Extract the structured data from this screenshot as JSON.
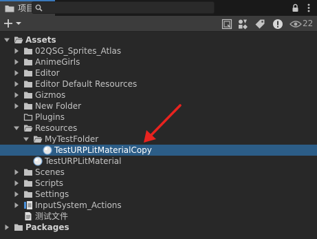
{
  "tab": {
    "label": "项目"
  },
  "toolbar": {
    "search_value": "",
    "search_placeholder": "",
    "hidden_count": "22"
  },
  "tree": [
    {
      "label": "Assets",
      "depth": 0,
      "expanded": true,
      "hasArrow": true,
      "icon": "folder-open",
      "bold": true,
      "selected": false
    },
    {
      "label": "02QSG_Sprites_Atlas",
      "depth": 1,
      "expanded": false,
      "hasArrow": true,
      "icon": "folder",
      "bold": false,
      "selected": false
    },
    {
      "label": "AnimeGirls",
      "depth": 1,
      "expanded": false,
      "hasArrow": true,
      "icon": "folder",
      "bold": false,
      "selected": false
    },
    {
      "label": "Editor",
      "depth": 1,
      "expanded": false,
      "hasArrow": true,
      "icon": "folder",
      "bold": false,
      "selected": false
    },
    {
      "label": "Editor Default Resources",
      "depth": 1,
      "expanded": false,
      "hasArrow": true,
      "icon": "folder",
      "bold": false,
      "selected": false
    },
    {
      "label": "Gizmos",
      "depth": 1,
      "expanded": false,
      "hasArrow": true,
      "icon": "folder",
      "bold": false,
      "selected": false
    },
    {
      "label": "New Folder",
      "depth": 1,
      "expanded": false,
      "hasArrow": true,
      "icon": "folder",
      "bold": false,
      "selected": false
    },
    {
      "label": "Plugins",
      "depth": 1,
      "expanded": false,
      "hasArrow": false,
      "icon": "folder-empty",
      "bold": false,
      "selected": false
    },
    {
      "label": "Resources",
      "depth": 1,
      "expanded": true,
      "hasArrow": true,
      "icon": "folder-open",
      "bold": false,
      "selected": false
    },
    {
      "label": "MyTestFolder",
      "depth": 2,
      "expanded": true,
      "hasArrow": true,
      "icon": "folder-open",
      "bold": false,
      "selected": false
    },
    {
      "label": "TestURPLitMaterialCopy",
      "depth": 3,
      "expanded": false,
      "hasArrow": false,
      "icon": "material",
      "bold": false,
      "selected": true
    },
    {
      "label": "TestURPLitMaterial",
      "depth": 2,
      "expanded": false,
      "hasArrow": false,
      "icon": "material",
      "bold": false,
      "selected": false
    },
    {
      "label": "Scenes",
      "depth": 1,
      "expanded": false,
      "hasArrow": true,
      "icon": "folder",
      "bold": false,
      "selected": false
    },
    {
      "label": "Scripts",
      "depth": 1,
      "expanded": false,
      "hasArrow": true,
      "icon": "folder",
      "bold": false,
      "selected": false
    },
    {
      "label": "Settings",
      "depth": 1,
      "expanded": false,
      "hasArrow": true,
      "icon": "folder",
      "bold": false,
      "selected": false
    },
    {
      "label": "InputSystem_Actions",
      "depth": 1,
      "expanded": false,
      "hasArrow": true,
      "icon": "input-actions",
      "bold": false,
      "selected": false
    },
    {
      "label": "测试文件",
      "depth": 1,
      "expanded": false,
      "hasArrow": false,
      "icon": "text-file",
      "bold": false,
      "selected": false
    },
    {
      "label": "Packages",
      "depth": 0,
      "expanded": false,
      "hasArrow": true,
      "icon": "folder",
      "bold": true,
      "selected": false
    }
  ],
  "colors": {
    "selection": "#2c5d87",
    "accent_tab": "#3a79bb",
    "annotation_arrow": "#e8231f"
  },
  "icons": {
    "tab": "folder-icon",
    "lock": "lock-icon",
    "menu": "kebab-menu-icon",
    "add": "plus-icon",
    "search": "search-icon",
    "search_by_type": "search-by-type-icon",
    "filter_type": "filter-type-icon",
    "filter_label": "tag-icon",
    "warning": "warning-icon",
    "hidden": "eye-icon"
  }
}
